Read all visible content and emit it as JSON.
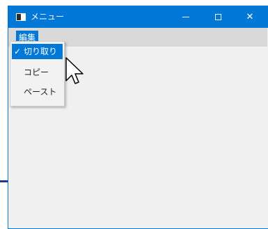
{
  "window": {
    "title": "メニュー",
    "controls": {
      "minimize": "minimize",
      "maximize": "maximize",
      "close": "✕"
    }
  },
  "menubar": {
    "edit_label": "編集"
  },
  "dropdown": {
    "items": [
      {
        "label": "切り取り",
        "checked": true,
        "check": "✓"
      },
      {
        "label": "コピー",
        "checked": false,
        "check": ""
      },
      {
        "label": "ペースト",
        "checked": false,
        "check": ""
      }
    ]
  },
  "colors": {
    "titlebar": "#0078d7",
    "selection": "#0078d7",
    "menubar": "#d9d9d9",
    "client": "#f0f0f0"
  }
}
